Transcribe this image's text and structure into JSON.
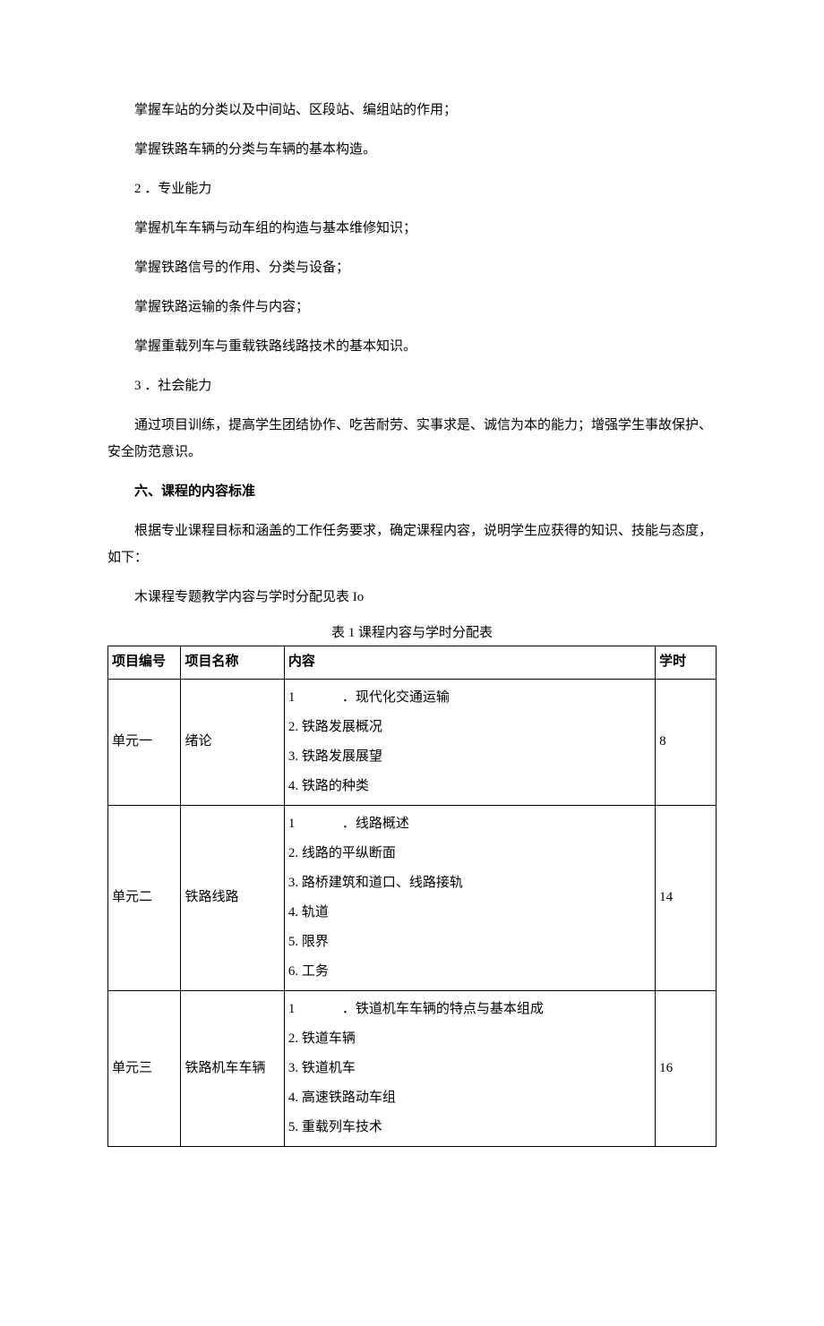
{
  "paragraphs": {
    "p1": "掌握车站的分类以及中间站、区段站、编组站的作用；",
    "p2": "掌握铁路车辆的分类与车辆的基本构造。",
    "p3": "2 ．专业能力",
    "p4": "掌握机车车辆与动车组的构造与基本维修知识；",
    "p5": "掌握铁路信号的作用、分类与设备；",
    "p6": "掌握铁路运输的条件与内容；",
    "p7": "掌握重载列车与重载铁路线路技术的基本知识。",
    "p8": "3 ．社会能力",
    "p9": "通过项目训练，提高学生团结协作、吃苦耐劳、实事求是、诚信为本的能力；增强学生事故保护、安全防范意识。"
  },
  "heading6": "六、课程的内容标准",
  "paragraphs2": {
    "p10": "根据专业课程目标和涵盖的工作任务要求，确定课程内容，说明学生应获得的知识、技能与态度，如下：",
    "p11": "木课程专题教学内容与学时分配见表 Io"
  },
  "table": {
    "caption": "表 1 课程内容与学时分配表",
    "headers": {
      "id": "项目编号",
      "name": "项目名称",
      "content": "内容",
      "hours": "学时"
    },
    "rows": [
      {
        "id": "单元一",
        "name": "绪论",
        "first_num": "1",
        "first_text": "．现代化交通运输",
        "lines": [
          "2. 铁路发展概况",
          "3. 铁路发展展望",
          "4. 铁路的种类"
        ],
        "hours": "8"
      },
      {
        "id": "单元二",
        "name": "铁路线路",
        "first_num": "1",
        "first_text": "．线路概述",
        "lines": [
          "2. 线路的平纵断面",
          "3. 路桥建筑和道口、线路接轨",
          "4. 轨道",
          "5. 限界",
          "6. 工务"
        ],
        "hours": "14"
      },
      {
        "id": "单元三",
        "name": "铁路机车车辆",
        "first_num": "1",
        "first_text": "．铁道机车车辆的特点与基本组成",
        "lines": [
          "2. 铁道车辆",
          "3. 铁道机车",
          "4. 高速铁路动车组",
          "5. 重载列车技术"
        ],
        "hours": "16"
      }
    ]
  }
}
